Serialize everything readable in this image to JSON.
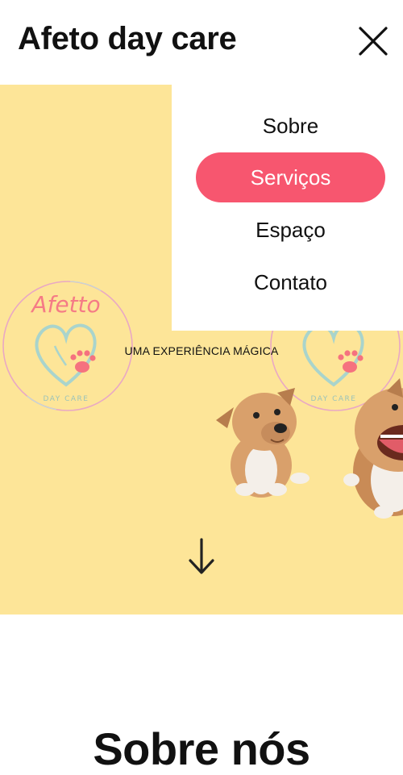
{
  "header": {
    "title": "Afeto day care",
    "close_icon": "close-icon"
  },
  "menu": {
    "items": [
      {
        "label": "Sobre",
        "active": false
      },
      {
        "label": "Serviços",
        "active": true
      },
      {
        "label": "Espaço",
        "active": false
      },
      {
        "label": "Contato",
        "active": false
      }
    ],
    "active_color": "#f7566f"
  },
  "hero": {
    "background": "#fde598",
    "tagline": "UMA EXPERIÊNCIA MÁGICA",
    "logo": {
      "name": "Afetto",
      "subtitle": "DAY CARE"
    },
    "scroll_icon": "arrow-down-icon"
  },
  "about": {
    "title": "Sobre nós"
  }
}
